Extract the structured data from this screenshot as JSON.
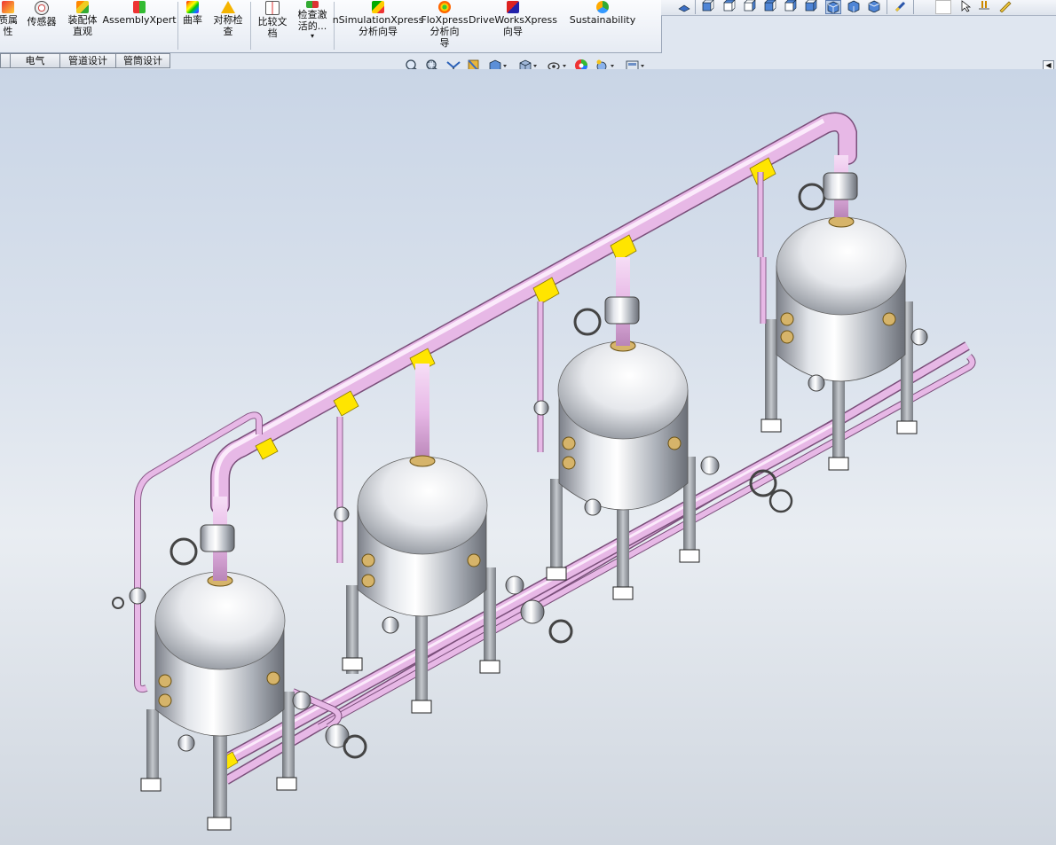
{
  "command_manager": {
    "items": [
      {
        "label_line1": "质属",
        "label_line2": "性",
        "icon": "mass-properties-icon"
      },
      {
        "label_line1": "传感器",
        "label_line2": "",
        "icon": "sensor-icon"
      },
      {
        "label_line1": "装配体",
        "label_line2": "直观",
        "icon": "assembly-visualization-icon"
      },
      {
        "label_line1": "AssemblyXpert",
        "label_line2": "",
        "icon": "assemblyxpert-icon"
      },
      {
        "label_line1": "曲率",
        "label_line2": "",
        "icon": "curvature-icon"
      },
      {
        "label_line1": "对称检",
        "label_line2": "查",
        "icon": "symmetry-check-icon"
      },
      {
        "label_line1": "比较文",
        "label_line2": "档",
        "icon": "compare-documents-icon"
      },
      {
        "label_line1": "检查激",
        "label_line2": "活的...",
        "icon": "check-active-document-icon"
      },
      {
        "label_line1": "nSimulationXpress",
        "label_line2": "分析向导",
        "icon": "simulationxpress-icon"
      },
      {
        "label_line1": "FloXpress",
        "label_line2": "分析向",
        "label_line3": "导",
        "icon": "floxpress-icon"
      },
      {
        "label_line1": "DriveWorksXpress",
        "label_line2": "向导",
        "icon": "driveworksxpress-icon"
      },
      {
        "label_line1": "Sustainability",
        "label_line2": "",
        "icon": "sustainability-icon"
      }
    ],
    "dropdown_glyph": "▾"
  },
  "tabs": [
    "",
    "电气",
    "管道设计",
    "管筒设计"
  ],
  "view_toolbar": {
    "icons": [
      "zoom-to-fit-icon",
      "zoom-to-area-icon",
      "previous-view-icon",
      "section-view-icon",
      "view-orientation-icon",
      "display-style-icon",
      "hide-show-items-icon",
      "edit-appearance-icon",
      "apply-scene-icon",
      "view-settings-icon"
    ]
  },
  "collapse_glyph": "◀",
  "colors": {
    "pipe": "#e7b8e6",
    "pipe_dark": "#b985b8",
    "coupling": "#ffe500",
    "steel": "#c8ccd2",
    "flange": "#d6b46a",
    "leg": "#a6aab1"
  }
}
